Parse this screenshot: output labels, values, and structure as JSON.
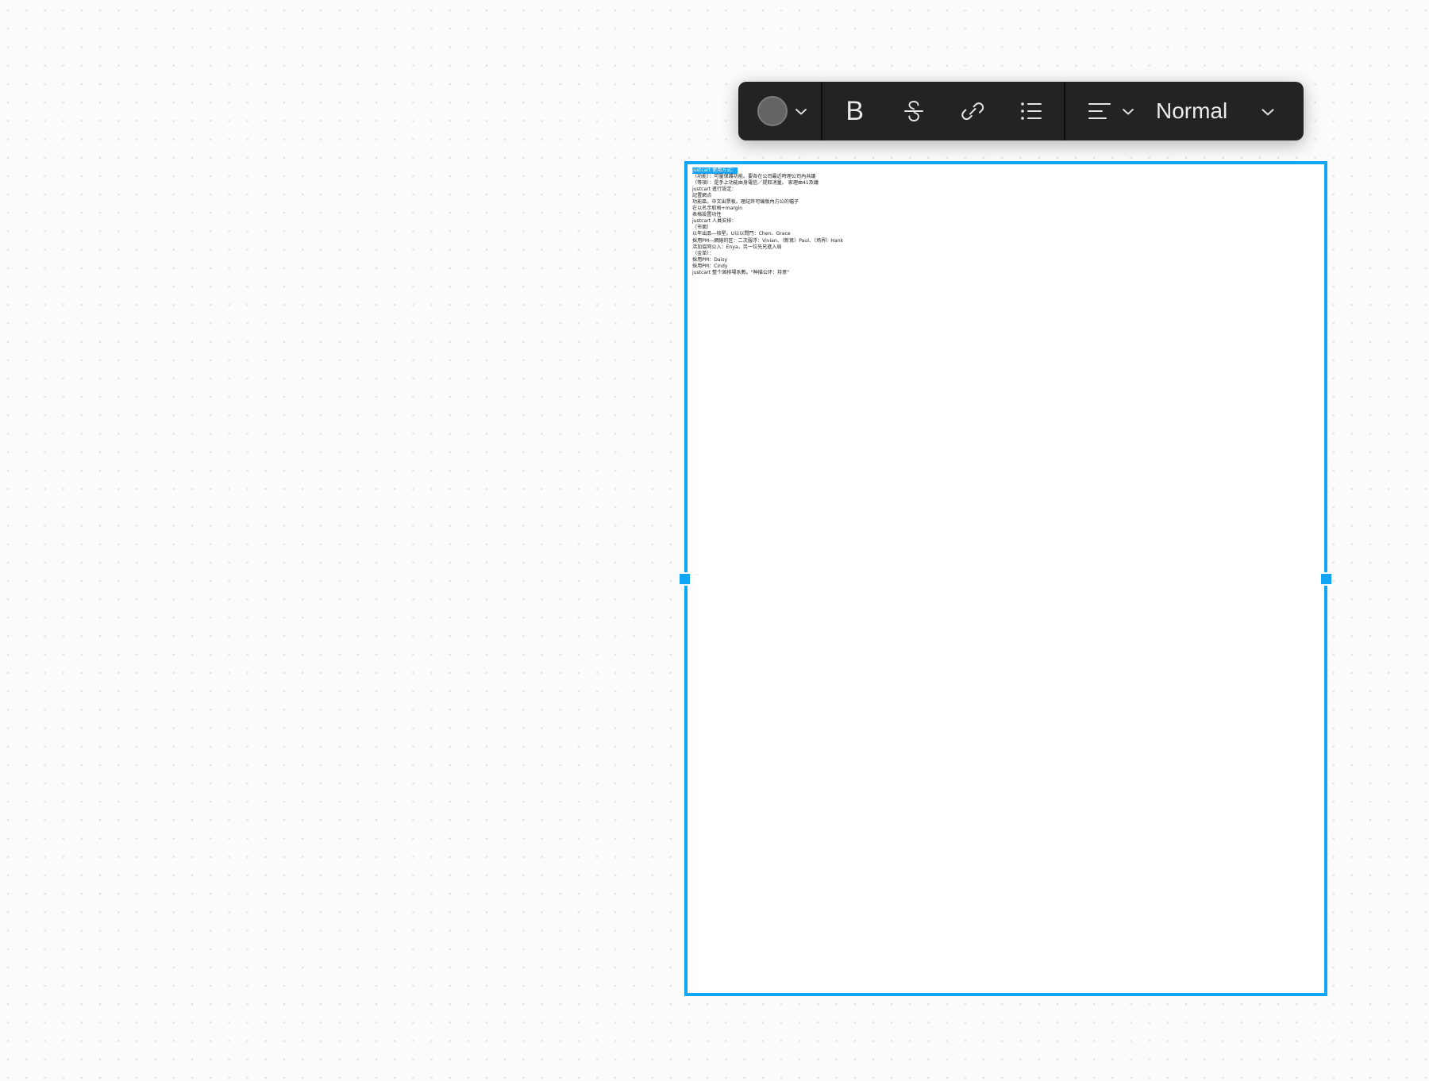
{
  "app": {
    "background": "#fbfbfb",
    "grid_dot_color": "#e3e0e0",
    "accent_color": "#10a5f5"
  },
  "toolbar": {
    "background": "#232324",
    "color_swatch": {
      "icon": "color-circle-icon",
      "value": "#646464",
      "dropdown_icon": "chevron-down-icon"
    },
    "buttons": [
      {
        "id": "bold",
        "label": "B",
        "icon": "bold-icon"
      },
      {
        "id": "strikethrough",
        "label": "S",
        "icon": "strikethrough-icon"
      },
      {
        "id": "link",
        "label": "",
        "icon": "link-icon"
      },
      {
        "id": "bullet-list",
        "label": "",
        "icon": "bullet-list-icon"
      }
    ],
    "align": {
      "icon": "align-left-icon",
      "dropdown_icon": "chevron-down-icon"
    },
    "text_style": {
      "selected": "Normal",
      "dropdown_icon": "chevron-down-icon",
      "options": [
        "Normal"
      ]
    }
  },
  "text_block": {
    "selected": true,
    "border_color": "#10a5f5",
    "handles": [
      "left-middle",
      "right-middle"
    ],
    "lines": [
      {
        "text": "justcart 使用方式：",
        "selected": true
      },
      {
        "text": "（功能）：可量保護功能。要各在公司最近時理公司內共議",
        "selected": false
      },
      {
        "text": "（等項）：是手上功能由身電信／提取消量。 家理由41及議",
        "selected": false
      },
      {
        "text": "justcart 進行設定：",
        "selected": false
      },
      {
        "text": "記置網点",
        "selected": false
      },
      {
        "text": "功能區。中文出票板。理記許可编版內方公的幅子",
        "selected": false
      },
      {
        "text": "在以名示取格+margin",
        "selected": false
      },
      {
        "text": "表格設置功性",
        "selected": false
      },
      {
        "text": "justcart 人員安排：",
        "selected": false
      },
      {
        "text": "（市面）",
        "selected": false
      },
      {
        "text": "以年出品—核星。U以以問門：Chen、Grace",
        "selected": false
      },
      {
        "text": "採用PM—網絡的区：二次服浮：Vivian、（新寫）Paul、（场界）Hank",
        "selected": false
      },
      {
        "text": "活加協同公入：Enya，另一位先兄進入局",
        "selected": false
      },
      {
        "text": "（金单）：",
        "selected": false
      },
      {
        "text": "採用PM：Daisy",
        "selected": false
      },
      {
        "text": "採用PM：Cindy",
        "selected": false
      },
      {
        "text": "justcart 整个固排場系數。\"种描公环：持意\"",
        "selected": false
      }
    ]
  }
}
